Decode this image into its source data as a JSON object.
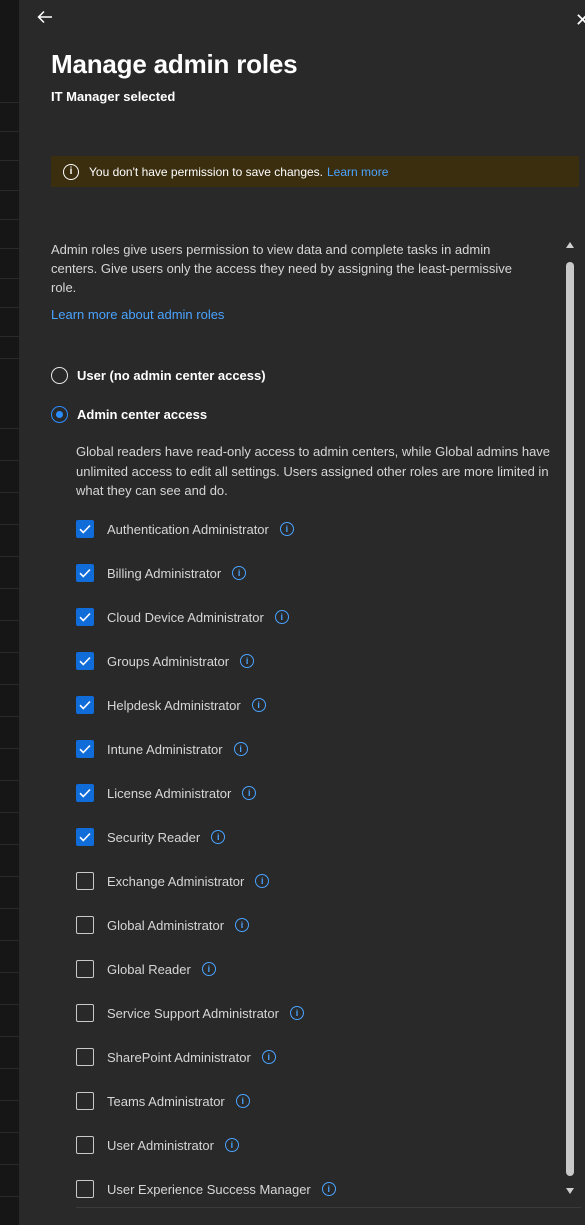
{
  "panel": {
    "back_icon": "arrow-left-icon",
    "close_icon": "close-icon",
    "title": "Manage admin roles",
    "subtitle": "IT Manager selected"
  },
  "banner": {
    "icon": "info-icon",
    "text": "You don't have permission to save changes.",
    "link": "Learn more",
    "background": "#3b2e0f"
  },
  "description": "Admin roles give users permission to view data and complete tasks in admin centers. Give users only the access they need by assigning the least-permissive role.",
  "learn_more_link": "Learn more about admin roles",
  "access_options": [
    {
      "label": "User (no admin center access)",
      "selected": false
    },
    {
      "label": "Admin center access",
      "selected": true
    }
  ],
  "admin_access_description": "Global readers have read-only access to admin centers, while Global admins have unlimited access to edit all settings. Users assigned other roles are more limited in what they can see and do.",
  "roles": [
    {
      "label": "Authentication Administrator",
      "checked": true
    },
    {
      "label": "Billing Administrator",
      "checked": true
    },
    {
      "label": "Cloud Device Administrator",
      "checked": true
    },
    {
      "label": "Groups Administrator",
      "checked": true
    },
    {
      "label": "Helpdesk Administrator",
      "checked": true
    },
    {
      "label": "Intune Administrator",
      "checked": true
    },
    {
      "label": "License Administrator",
      "checked": true
    },
    {
      "label": "Security Reader",
      "checked": true
    },
    {
      "label": "Exchange Administrator",
      "checked": false
    },
    {
      "label": "Global Administrator",
      "checked": false
    },
    {
      "label": "Global Reader",
      "checked": false
    },
    {
      "label": "Service Support Administrator",
      "checked": false
    },
    {
      "label": "SharePoint Administrator",
      "checked": false
    },
    {
      "label": "Teams Administrator",
      "checked": false
    },
    {
      "label": "User Administrator",
      "checked": false
    },
    {
      "label": "User Experience Success Manager",
      "checked": false
    }
  ],
  "colors": {
    "accent": "#0f6cd8",
    "link": "#4aa3ff",
    "panel_bg": "#292929"
  }
}
